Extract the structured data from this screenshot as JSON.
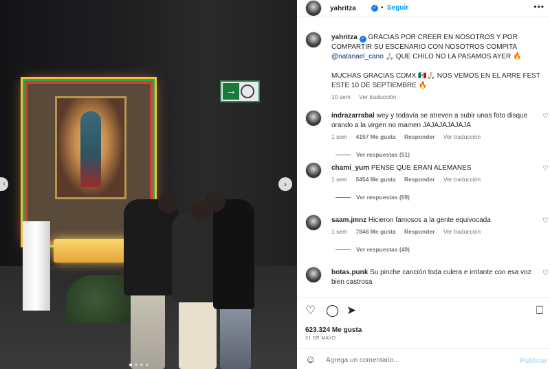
{
  "post": {
    "author": "yahritza",
    "follow_label": "Seguir",
    "dot": "•",
    "more": "•••",
    "caption": {
      "author": "yahritza",
      "text1": "GRACIAS POR CREER EN NOSOTROS Y POR COMPARTIR SU ESCENARIO CON NOSOTROS COMPITA",
      "mention": "@natanael_cano",
      "text2": "🙏🏻 QUE CHILO NO LA PASAMOS AYER 🔥",
      "text3": "MUCHAS GRACIAS CDMX 🇲🇽🙏🏻 NOS VEMOS EN EL ARRE FEST ESTE 10 DE SEPTIEMBRE 🔥",
      "time": "10 sem",
      "translate": "Ver traducción"
    },
    "comments": [
      {
        "user": "indrazarrabal",
        "text": "wey y todavía se atreven a subir unas foto disque orando a la virgen no mamen JAJAJAJAJAJA",
        "time": "1 sem",
        "likes": "4157 Me gusta",
        "reply": "Responder",
        "translate": "Ver traducción",
        "replies": "Ver respuestas (51)"
      },
      {
        "user": "chami_yum",
        "text": "PENSE QUE ERAN ALEMANES",
        "time": "1 sem",
        "likes": "5454 Me gusta",
        "reply": "Responder",
        "translate": "Ver traducción",
        "replies": "Ver respuestas (69)"
      },
      {
        "user": "saam.jmnz",
        "text": "Hicieron famosos a la gente equivocada",
        "time": "1 sem",
        "likes": "7848 Me gusta",
        "reply": "Responder",
        "translate": "Ver traducción",
        "replies": "Ver respuestas (49)"
      },
      {
        "user": "botas.punk",
        "text": "Su pinche canción toda culera e irritante con esa voz bien castrosa"
      }
    ],
    "likes_count": "623.324 Me gusta",
    "date": "31 DE MAYO",
    "add_comment_placeholder": "Agrega un comentario...",
    "publish_label": "Publicar",
    "carousel": {
      "active_index": 0,
      "count": 4
    },
    "icons": {
      "like": "heart-icon",
      "comment": "comment-icon",
      "share": "share-icon",
      "save": "bookmark-icon",
      "emoji": "emoji-icon",
      "next": "chevron-right-icon",
      "prev": "chevron-left-icon"
    },
    "colors": {
      "accent": "#0095f6",
      "verified": "#1877f2",
      "mention": "#00376b",
      "muted": "#737373"
    }
  }
}
